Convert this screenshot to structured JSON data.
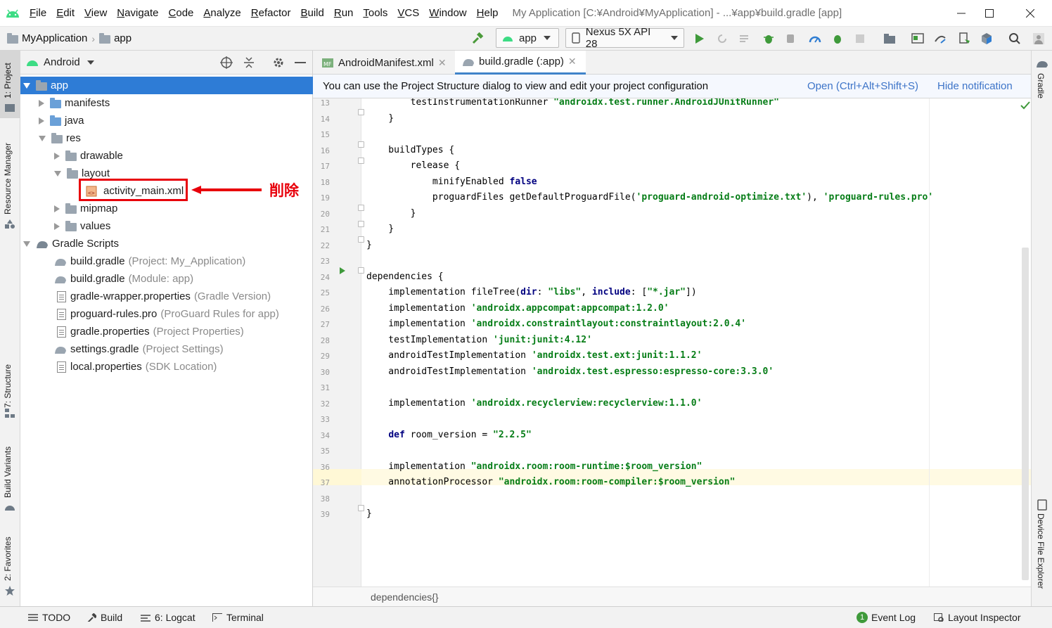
{
  "menu": {
    "items": [
      "File",
      "Edit",
      "View",
      "Navigate",
      "Code",
      "Analyze",
      "Refactor",
      "Build",
      "Run",
      "Tools",
      "VCS",
      "Window",
      "Help"
    ],
    "title": "My Application [C:¥Android¥MyApplication] - ...¥app¥build.gradle [app]"
  },
  "navbar": {
    "project": "MyApplication",
    "module": "app",
    "run_config": "app",
    "device": "Nexus 5X API 28"
  },
  "left_tabs": [
    "1: Project",
    "Resource Manager",
    "7: Structure",
    "Build Variants",
    "2: Favorites"
  ],
  "right_tabs": [
    "Gradle",
    "Device File Explorer"
  ],
  "project_panel": {
    "view": "Android",
    "tree": [
      {
        "label": "app",
        "hint": ""
      },
      {
        "label": "manifests",
        "hint": ""
      },
      {
        "label": "java",
        "hint": ""
      },
      {
        "label": "res",
        "hint": ""
      },
      {
        "label": "drawable",
        "hint": ""
      },
      {
        "label": "layout",
        "hint": ""
      },
      {
        "label": "activity_main.xml",
        "hint": ""
      },
      {
        "label": "mipmap",
        "hint": ""
      },
      {
        "label": "values",
        "hint": ""
      },
      {
        "label": "Gradle Scripts",
        "hint": ""
      },
      {
        "label": "build.gradle",
        "hint": "(Project: My_Application)"
      },
      {
        "label": "build.gradle",
        "hint": "(Module: app)"
      },
      {
        "label": "gradle-wrapper.properties",
        "hint": "(Gradle Version)"
      },
      {
        "label": "proguard-rules.pro",
        "hint": "(ProGuard Rules for app)"
      },
      {
        "label": "gradle.properties",
        "hint": "(Project Properties)"
      },
      {
        "label": "settings.gradle",
        "hint": "(Project Settings)"
      },
      {
        "label": "local.properties",
        "hint": "(SDK Location)"
      }
    ]
  },
  "annotation": {
    "label": "削除"
  },
  "editor_tabs": [
    {
      "label": "AndroidManifest.xml",
      "active": false
    },
    {
      "label": "build.gradle (:app)",
      "active": true
    }
  ],
  "notification": {
    "message": "You can use the Project Structure dialog to view and edit your project configuration",
    "open_link": "Open (Ctrl+Alt+Shift+S)",
    "hide_link": "Hide notification"
  },
  "code_lines": [
    {
      "n": "13",
      "text": "        testInstrumentationRunner \"androidx.test.runner.AndroidJUnitRunner\""
    },
    {
      "n": "14",
      "text": "    }"
    },
    {
      "n": "15",
      "text": ""
    },
    {
      "n": "16",
      "text": "    buildTypes {"
    },
    {
      "n": "17",
      "text": "        release {"
    },
    {
      "n": "18",
      "text": "            minifyEnabled false"
    },
    {
      "n": "19",
      "text": "            proguardFiles getDefaultProguardFile('proguard-android-optimize.txt'), 'proguard-rules.pro'"
    },
    {
      "n": "20",
      "text": "        }"
    },
    {
      "n": "21",
      "text": "    }"
    },
    {
      "n": "22",
      "text": "}"
    },
    {
      "n": "23",
      "text": ""
    },
    {
      "n": "24",
      "text": "dependencies {"
    },
    {
      "n": "25",
      "text": "    implementation fileTree(dir: \"libs\", include: [\"*.jar\"])"
    },
    {
      "n": "26",
      "text": "    implementation 'androidx.appcompat:appcompat:1.2.0'"
    },
    {
      "n": "27",
      "text": "    implementation 'androidx.constraintlayout:constraintlayout:2.0.4'"
    },
    {
      "n": "28",
      "text": "    testImplementation 'junit:junit:4.12'"
    },
    {
      "n": "29",
      "text": "    androidTestImplementation 'androidx.test.ext:junit:1.1.2'"
    },
    {
      "n": "30",
      "text": "    androidTestImplementation 'androidx.test.espresso:espresso-core:3.3.0'"
    },
    {
      "n": "31",
      "text": ""
    },
    {
      "n": "32",
      "text": "    implementation 'androidx.recyclerview:recyclerview:1.1.0'"
    },
    {
      "n": "33",
      "text": ""
    },
    {
      "n": "34",
      "text": "    def room_version = \"2.2.5\""
    },
    {
      "n": "35",
      "text": ""
    },
    {
      "n": "36",
      "text": "    implementation \"androidx.room:room-runtime:$room_version\""
    },
    {
      "n": "37",
      "text": "    annotationProcessor \"androidx.room:room-compiler:$room_version\""
    },
    {
      "n": "38",
      "text": ""
    },
    {
      "n": "39",
      "text": "}"
    }
  ],
  "editor_breadcrumb": "dependencies{}",
  "statusbar": {
    "todo": "TODO",
    "build": "Build",
    "logcat": "6: Logcat",
    "terminal": "Terminal",
    "event_log": "Event Log",
    "event_log_count": "1",
    "layout_inspector": "Layout Inspector"
  },
  "colors": {
    "selection": "#2e7cd6",
    "annotation_red": "#e8000b",
    "keyword": "#000080",
    "string": "#067d17",
    "link": "#3d74c8"
  }
}
